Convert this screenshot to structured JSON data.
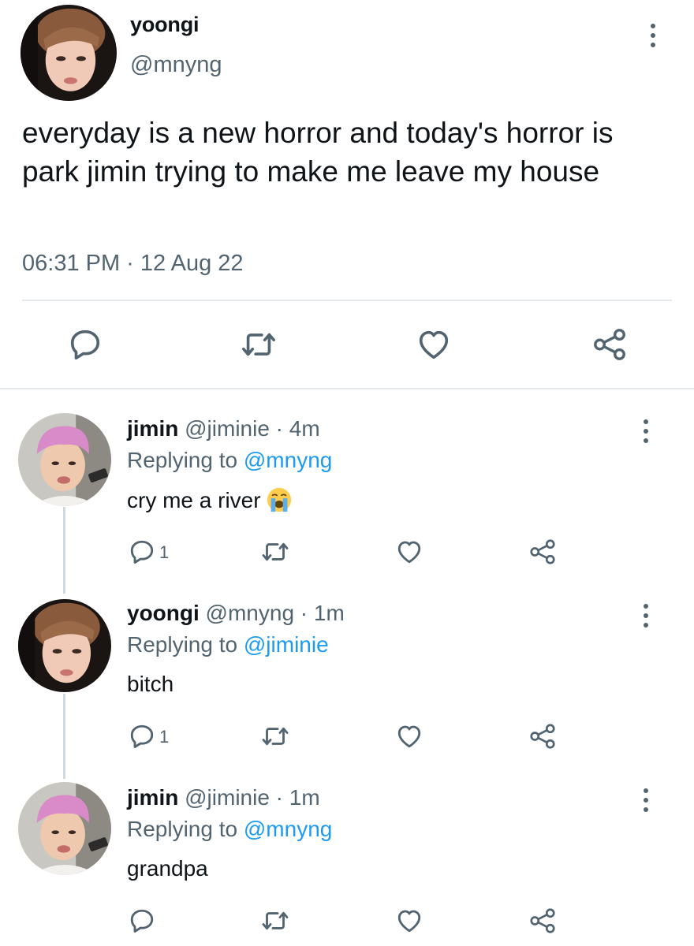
{
  "main_tweet": {
    "display_name": "yoongi",
    "handle": "@mnyng",
    "text": "everyday is a new horror and today's horror is park jimin trying to make me leave my house",
    "timestamp": "06:31 PM · 12 Aug 22",
    "actions": [
      "reply-icon",
      "retweet-icon",
      "like-icon",
      "share-icon"
    ]
  },
  "replies": [
    {
      "display_name": "jimin",
      "meta": "@jiminie · 4m",
      "replying_prefix": "Replying to",
      "replying_to": "@mnyng",
      "text": "cry me a river",
      "emoji": "loudly-crying-face",
      "reply_count": "1"
    },
    {
      "display_name": "yoongi",
      "meta": "@mnyng · 1m",
      "replying_prefix": "Replying to",
      "replying_to": "@jiminie",
      "text": "bitch",
      "reply_count": "1"
    },
    {
      "display_name": "jimin",
      "meta": "@jiminie · 1m",
      "replying_prefix": "Replying to",
      "replying_to": "@mnyng",
      "text": "grandpa",
      "reply_count": ""
    }
  ],
  "colors": {
    "text": "#0f1419",
    "muted": "#536471",
    "link": "#1d9bf0",
    "divider": "#e6e9eb",
    "thread_line": "#cfd9de"
  }
}
